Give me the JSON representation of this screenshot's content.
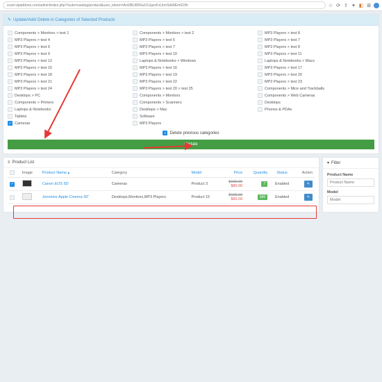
{
  "url": "xcart.vipaddons.com/admin/index.php?route=catalog/product&user_token=IAnt3BU8D6aXXUgvxFzUnrrSikWEmSOIh",
  "panel_title": "Update/Add/ Delete in Categories of Selected Products",
  "categories": {
    "col1": [
      "Components > Monitors > test 1",
      "MP3 Players > test 4",
      "MP3 Players > test 6",
      "MP3 Players > test 9",
      "MP3 Players > test 12",
      "MP3 Players > test 15",
      "MP3 Players > test 18",
      "MP3 Players > test 21",
      "MP3 Players > test 24",
      "Desktops > PC",
      "Components > Printers",
      "Laptops & Notebooks",
      "Tablets",
      "Cameras"
    ],
    "col2": [
      "Components > Monitors > test 2",
      "MP3 Players > test 5",
      "MP3 Players > test 7",
      "MP3 Players > test 10",
      "Laptops & Notebooks > Windows",
      "MP3 Players > test 16",
      "MP3 Players > test 19",
      "MP3 Players > test 22",
      "MP3 Players > test 20 > test 25",
      "Components > Monitors",
      "Components > Scanners",
      "Desktops > Mac",
      "Software",
      "MP3 Players"
    ],
    "col3": [
      "MP3 Players > test 8",
      "MP3 Players > test 7",
      "MP3 Players > test 8",
      "MP3 Players > test 11",
      "Laptops & Notebooks > Macs",
      "MP3 Players > test 17",
      "MP3 Players > test 20",
      "MP3 Players > test 23",
      "Components > Mice and Trackballs",
      "Components > Web Cameras",
      "Desktops",
      "Phones & PDAs"
    ]
  },
  "checked": [
    "Cameras"
  ],
  "delete_label": "Delete previous categories",
  "update_label": "Update",
  "product_list_title": "Product List",
  "filter_title": "Filter",
  "th": {
    "image": "Image",
    "name": "Product Name ▴",
    "category": "Category",
    "model": "Model",
    "price": "Price",
    "qty": "Quantity",
    "status": "Status",
    "action": "Action"
  },
  "rows": [
    {
      "name": "Canon EOS 5D",
      "cat": "Cameras",
      "model": "Product 3",
      "p1": "$100.00",
      "p2": "$80.00",
      "qty": "7",
      "status": "Enabled",
      "thumb": "dark"
    },
    {
      "name": "Jenneive Apple Cinema 30\"",
      "cat": "Desktops,Monitors,MP3 Players",
      "model": "Product 15",
      "p1": "$100.00",
      "p2": "$90.00",
      "qty": "990",
      "status": "Enabled",
      "thumb": "light"
    }
  ],
  "filter": {
    "name_label": "Product Name",
    "name_ph": "Product Name",
    "model_label": "Model",
    "model_ph": "Model"
  },
  "pencil": "✎",
  "check": "✓",
  "list_icon": "≡",
  "filter_icon": "▾"
}
